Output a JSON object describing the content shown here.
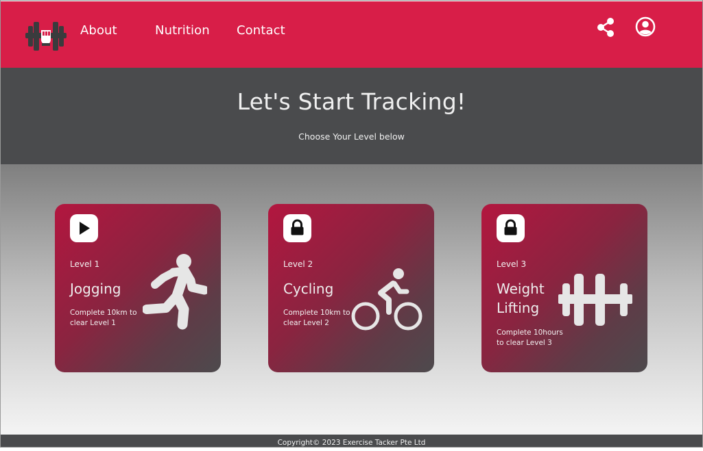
{
  "nav": {
    "links": [
      "About",
      "Nutrition",
      "Contact"
    ],
    "icons": {
      "logo": "fist-dumbbell-logo",
      "share": "share-icon",
      "account": "account-circle-icon"
    },
    "background": "#d81e48"
  },
  "hero": {
    "title": "Let's Start Tracking!",
    "subtitle": "Choose Your Level below",
    "background": "#4a4b4d"
  },
  "cards": [
    {
      "level": "Level 1",
      "title": "Jogging",
      "description": "Complete 10km to clear Level 1",
      "badge_icon": "play-icon",
      "art_icon": "running-person-icon"
    },
    {
      "level": "Level 2",
      "title": "Cycling",
      "description": "Complete 10km to clear Level 2",
      "badge_icon": "lock-icon",
      "art_icon": "cyclist-icon"
    },
    {
      "level": "Level 3",
      "title": "Weight Lifting",
      "description": "Complete 10hours to clear Level 3",
      "badge_icon": "lock-icon",
      "art_icon": "dumbbell-icon"
    }
  ],
  "footer": {
    "copyright": "Copyright© 2023 Exercise Tacker Pte Ltd"
  }
}
